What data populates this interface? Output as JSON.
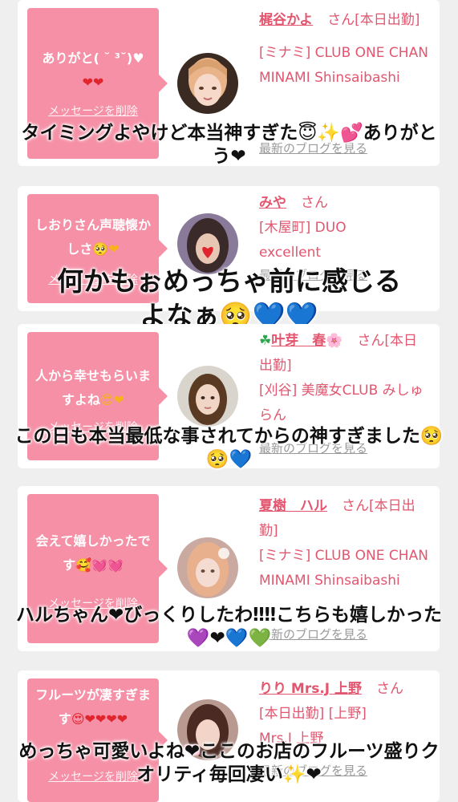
{
  "cards": [
    {
      "message": "ありがと( ˘ ³˘)♥",
      "message_emoji": "❤❤",
      "delete_label": "メッセージを削除",
      "name": "梶谷かよ",
      "suffix": "さん[本日出勤]",
      "shop": "[ミナミ] CLUB ONE CHAN MINAMI Shinsaibashi",
      "blog_label": "最新のブログを見る",
      "overlay": "タイミングよやけど本当神すぎた😇✨💕ありがとう❤"
    },
    {
      "message": "しおりさん声聴懐かしさ",
      "message_emoji": "🥺❤",
      "delete_label": "メッセージを削除",
      "name": "みや",
      "suffix": "さん",
      "shop": "[木屋町] DUO excellent",
      "blog_label": "最新のブログを見る",
      "overlay": "何かもぉめっちゃ前に感じるよなぁ🥺💙💙"
    },
    {
      "message": "人から幸せもらいますよね",
      "message_emoji": "😍❤",
      "delete_label": "メッセージを削除",
      "name_prefix_icon": "☘",
      "name": "叶芽　春",
      "name_suffix_icon": "🌸",
      "suffix": "さん[本日出勤]",
      "shop": "[刈谷] 美魔女CLUB みしゅらん",
      "blog_label": "最新のブログを見る",
      "overlay": "この日も本当最低な事されてからの神すぎました🥺🥺💙"
    },
    {
      "message": "会えて嬉しかったです",
      "message_emoji": "🥰💓💓",
      "delete_label": "メッセージを削除",
      "name": "夏樹　ハル",
      "suffix": "さん[本日出勤]",
      "shop": "[ミナミ] CLUB ONE CHAN MINAMI Shinsaibashi",
      "blog_label": "最新のブログを見る",
      "overlay": "ハルちゃん❤びっくりしたわ‼‼こちらも嬉しかった💜❤💙💚"
    },
    {
      "message": "フルーツが凄すぎます",
      "message_emoji": "😍❤❤❤❤",
      "delete_label": "メッセージを削除",
      "name": "りり Mrs.J 上野",
      "suffix": "さん",
      "shop": "[本日出勤] [上野] Mrs.J 上野",
      "blog_label": "最新のブログを見る",
      "overlay": "めっちゃ可愛いよね❤ここのお店のフルーツ盛りクオリティ毎回凄い✨❤"
    }
  ],
  "colors": {
    "bubble": "#f590a6",
    "name": "#e2566f",
    "background": "#efefef"
  }
}
